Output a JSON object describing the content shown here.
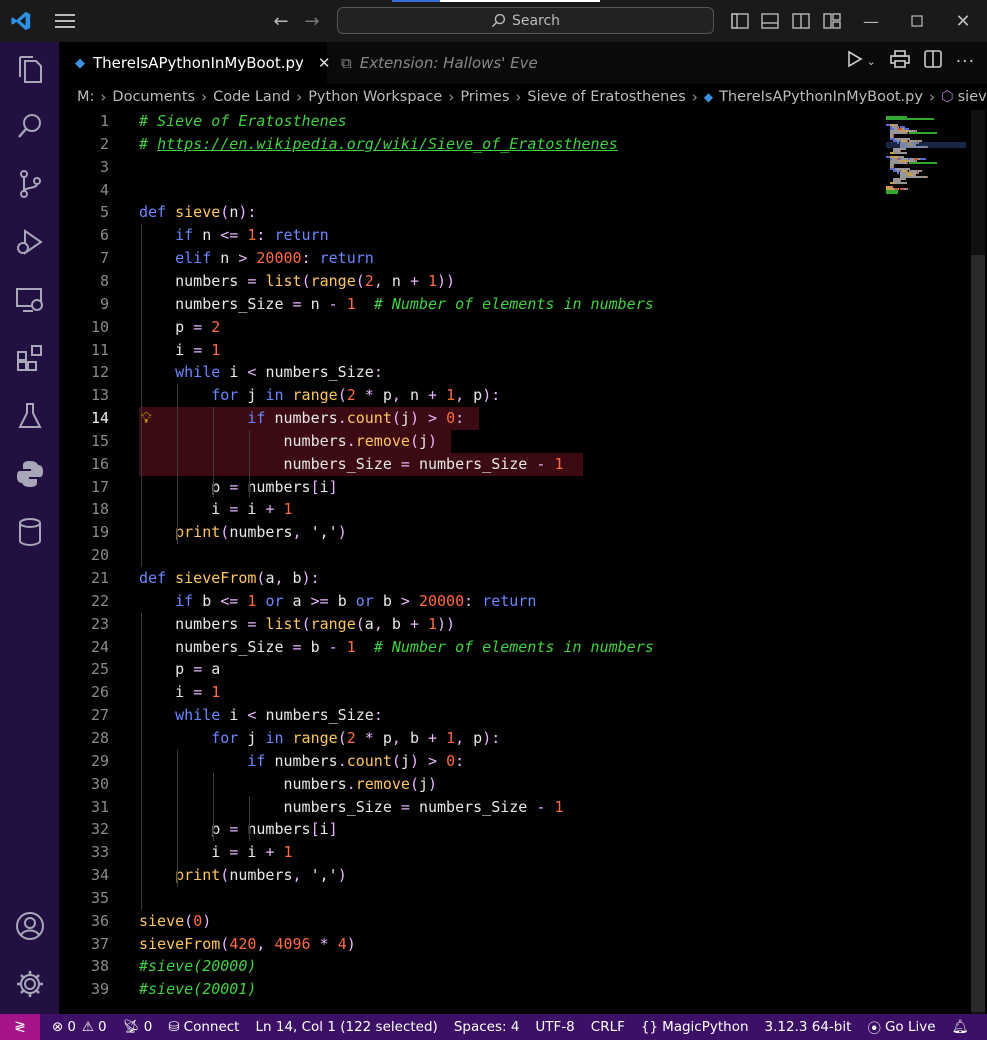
{
  "titlebar": {
    "search_placeholder": "Search"
  },
  "tabs": [
    {
      "label": "ThereIsAPythonInMyBoot.py",
      "active": true
    },
    {
      "label": "Extension: Hallows' Eve",
      "active": false
    }
  ],
  "breadcrumb": [
    "M:",
    "Documents",
    "Code Land",
    "Python Workspace",
    "Primes",
    "Sieve of Eratosthenes",
    "ThereIsAPythonInMyBoot.py",
    "sieve"
  ],
  "editor": {
    "current_line": 14,
    "selection_lines": [
      14,
      15,
      16
    ]
  },
  "code_lines": [
    [
      [
        "c",
        "# Sieve of Eratosthenes"
      ]
    ],
    [
      [
        "c",
        "# "
      ],
      [
        "cu",
        "https://en.wikipedia.org/wiki/Sieve_of_Eratosthenes"
      ]
    ],
    [],
    [],
    [
      [
        "k",
        "def "
      ],
      [
        "f",
        "sieve"
      ],
      [
        "o",
        "("
      ],
      [
        "t",
        "n"
      ],
      [
        "o",
        "):"
      ]
    ],
    [
      [
        "t",
        "    "
      ],
      [
        "k",
        "if "
      ],
      [
        "t",
        "n "
      ],
      [
        "o",
        "<= "
      ],
      [
        "n",
        "1"
      ],
      [
        "o",
        ": "
      ],
      [
        "k",
        "return"
      ]
    ],
    [
      [
        "t",
        "    "
      ],
      [
        "k",
        "elif "
      ],
      [
        "t",
        "n "
      ],
      [
        "o",
        "> "
      ],
      [
        "n",
        "20000"
      ],
      [
        "o",
        ": "
      ],
      [
        "k",
        "return"
      ]
    ],
    [
      [
        "t",
        "    numbers "
      ],
      [
        "o",
        "= "
      ],
      [
        "f",
        "list"
      ],
      [
        "o",
        "("
      ],
      [
        "f",
        "range"
      ],
      [
        "o",
        "("
      ],
      [
        "n",
        "2"
      ],
      [
        "o",
        ", "
      ],
      [
        "t",
        "n "
      ],
      [
        "o",
        "+ "
      ],
      [
        "n",
        "1"
      ],
      [
        "o",
        "))"
      ]
    ],
    [
      [
        "t",
        "    numbers_Size "
      ],
      [
        "o",
        "= "
      ],
      [
        "t",
        "n "
      ],
      [
        "o",
        "- "
      ],
      [
        "n",
        "1"
      ],
      [
        "t",
        "  "
      ],
      [
        "c",
        "# Number of elements in numbers"
      ]
    ],
    [
      [
        "t",
        "    p "
      ],
      [
        "o",
        "= "
      ],
      [
        "n",
        "2"
      ]
    ],
    [
      [
        "t",
        "    i "
      ],
      [
        "o",
        "= "
      ],
      [
        "n",
        "1"
      ]
    ],
    [
      [
        "t",
        "    "
      ],
      [
        "k",
        "while "
      ],
      [
        "t",
        "i "
      ],
      [
        "o",
        "< "
      ],
      [
        "t",
        "numbers_Size"
      ],
      [
        "o",
        ":"
      ]
    ],
    [
      [
        "t",
        "        "
      ],
      [
        "k",
        "for "
      ],
      [
        "t",
        "j "
      ],
      [
        "k",
        "in "
      ],
      [
        "f",
        "range"
      ],
      [
        "o",
        "("
      ],
      [
        "n",
        "2 "
      ],
      [
        "o",
        "* "
      ],
      [
        "t",
        "p"
      ],
      [
        "o",
        ", "
      ],
      [
        "t",
        "n "
      ],
      [
        "o",
        "+ "
      ],
      [
        "n",
        "1"
      ],
      [
        "o",
        ", "
      ],
      [
        "t",
        "p"
      ],
      [
        "o",
        "):"
      ]
    ],
    [
      [
        "t",
        "            "
      ],
      [
        "k",
        "if "
      ],
      [
        "t",
        "numbers"
      ],
      [
        "o",
        "."
      ],
      [
        "f",
        "count"
      ],
      [
        "o",
        "("
      ],
      [
        "t",
        "j"
      ],
      [
        "o",
        ") > "
      ],
      [
        "n",
        "0"
      ],
      [
        "o",
        ":"
      ]
    ],
    [
      [
        "t",
        "                numbers"
      ],
      [
        "o",
        "."
      ],
      [
        "f",
        "remove"
      ],
      [
        "o",
        "("
      ],
      [
        "t",
        "j"
      ],
      [
        "o",
        ")"
      ]
    ],
    [
      [
        "t",
        "                numbers_Size "
      ],
      [
        "o",
        "= "
      ],
      [
        "t",
        "numbers_Size "
      ],
      [
        "o",
        "- "
      ],
      [
        "n",
        "1"
      ]
    ],
    [
      [
        "t",
        "        p "
      ],
      [
        "o",
        "= "
      ],
      [
        "t",
        "numbers"
      ],
      [
        "o",
        "["
      ],
      [
        "t",
        "i"
      ],
      [
        "o",
        "]"
      ]
    ],
    [
      [
        "t",
        "        i "
      ],
      [
        "o",
        "= "
      ],
      [
        "t",
        "i "
      ],
      [
        "o",
        "+ "
      ],
      [
        "n",
        "1"
      ]
    ],
    [
      [
        "t",
        "    "
      ],
      [
        "f",
        "print"
      ],
      [
        "o",
        "("
      ],
      [
        "t",
        "numbers"
      ],
      [
        "o",
        ", "
      ],
      [
        "s",
        "','"
      ],
      [
        "o",
        ")"
      ]
    ],
    [],
    [
      [
        "k",
        "def "
      ],
      [
        "f",
        "sieveFrom"
      ],
      [
        "o",
        "("
      ],
      [
        "t",
        "a"
      ],
      [
        "o",
        ", "
      ],
      [
        "t",
        "b"
      ],
      [
        "o",
        "):"
      ]
    ],
    [
      [
        "t",
        "    "
      ],
      [
        "k",
        "if "
      ],
      [
        "t",
        "b "
      ],
      [
        "o",
        "<= "
      ],
      [
        "n",
        "1 "
      ],
      [
        "k",
        "or "
      ],
      [
        "t",
        "a "
      ],
      [
        "o",
        ">= "
      ],
      [
        "t",
        "b "
      ],
      [
        "k",
        "or "
      ],
      [
        "t",
        "b "
      ],
      [
        "o",
        "> "
      ],
      [
        "n",
        "20000"
      ],
      [
        "o",
        ": "
      ],
      [
        "k",
        "return"
      ]
    ],
    [
      [
        "t",
        "    numbers "
      ],
      [
        "o",
        "= "
      ],
      [
        "f",
        "list"
      ],
      [
        "o",
        "("
      ],
      [
        "f",
        "range"
      ],
      [
        "o",
        "("
      ],
      [
        "t",
        "a"
      ],
      [
        "o",
        ", "
      ],
      [
        "t",
        "b "
      ],
      [
        "o",
        "+ "
      ],
      [
        "n",
        "1"
      ],
      [
        "o",
        "))"
      ]
    ],
    [
      [
        "t",
        "    numbers_Size "
      ],
      [
        "o",
        "= "
      ],
      [
        "t",
        "b "
      ],
      [
        "o",
        "- "
      ],
      [
        "n",
        "1"
      ],
      [
        "t",
        "  "
      ],
      [
        "c",
        "# Number of elements in numbers"
      ]
    ],
    [
      [
        "t",
        "    p "
      ],
      [
        "o",
        "= "
      ],
      [
        "t",
        "a"
      ]
    ],
    [
      [
        "t",
        "    i "
      ],
      [
        "o",
        "= "
      ],
      [
        "n",
        "1"
      ]
    ],
    [
      [
        "t",
        "    "
      ],
      [
        "k",
        "while "
      ],
      [
        "t",
        "i "
      ],
      [
        "o",
        "< "
      ],
      [
        "t",
        "numbers_Size"
      ],
      [
        "o",
        ":"
      ]
    ],
    [
      [
        "t",
        "        "
      ],
      [
        "k",
        "for "
      ],
      [
        "t",
        "j "
      ],
      [
        "k",
        "in "
      ],
      [
        "f",
        "range"
      ],
      [
        "o",
        "("
      ],
      [
        "n",
        "2 "
      ],
      [
        "o",
        "* "
      ],
      [
        "t",
        "p"
      ],
      [
        "o",
        ", "
      ],
      [
        "t",
        "b "
      ],
      [
        "o",
        "+ "
      ],
      [
        "n",
        "1"
      ],
      [
        "o",
        ", "
      ],
      [
        "t",
        "p"
      ],
      [
        "o",
        "):"
      ]
    ],
    [
      [
        "t",
        "            "
      ],
      [
        "k",
        "if "
      ],
      [
        "t",
        "numbers"
      ],
      [
        "o",
        "."
      ],
      [
        "f",
        "count"
      ],
      [
        "o",
        "("
      ],
      [
        "t",
        "j"
      ],
      [
        "o",
        ") > "
      ],
      [
        "n",
        "0"
      ],
      [
        "o",
        ":"
      ]
    ],
    [
      [
        "t",
        "                numbers"
      ],
      [
        "o",
        "."
      ],
      [
        "f",
        "remove"
      ],
      [
        "o",
        "("
      ],
      [
        "t",
        "j"
      ],
      [
        "o",
        ")"
      ]
    ],
    [
      [
        "t",
        "                numbers_Size "
      ],
      [
        "o",
        "= "
      ],
      [
        "t",
        "numbers_Size "
      ],
      [
        "o",
        "- "
      ],
      [
        "n",
        "1"
      ]
    ],
    [
      [
        "t",
        "        p "
      ],
      [
        "o",
        "= "
      ],
      [
        "t",
        "numbers"
      ],
      [
        "o",
        "["
      ],
      [
        "t",
        "i"
      ],
      [
        "o",
        "]"
      ]
    ],
    [
      [
        "t",
        "        i "
      ],
      [
        "o",
        "= "
      ],
      [
        "t",
        "i "
      ],
      [
        "o",
        "+ "
      ],
      [
        "n",
        "1"
      ]
    ],
    [
      [
        "t",
        "    "
      ],
      [
        "f",
        "print"
      ],
      [
        "o",
        "("
      ],
      [
        "t",
        "numbers"
      ],
      [
        "o",
        ", "
      ],
      [
        "s",
        "','"
      ],
      [
        "o",
        ")"
      ]
    ],
    [],
    [
      [
        "f",
        "sieve"
      ],
      [
        "o",
        "("
      ],
      [
        "n",
        "0"
      ],
      [
        "o",
        ")"
      ]
    ],
    [
      [
        "f",
        "sieveFrom"
      ],
      [
        "o",
        "("
      ],
      [
        "n",
        "420"
      ],
      [
        "o",
        ", "
      ],
      [
        "n",
        "4096 "
      ],
      [
        "o",
        "* "
      ],
      [
        "n",
        "4"
      ],
      [
        "o",
        ")"
      ]
    ],
    [
      [
        "c",
        "#sieve(20000)"
      ]
    ],
    [
      [
        "c",
        "#sieve(20001)"
      ]
    ]
  ],
  "status": {
    "errors": "0",
    "warnings": "0",
    "ports": "0",
    "connect": "Connect",
    "position": "Ln 14, Col 1 (122 selected)",
    "spaces": "Spaces: 4",
    "encoding": "UTF-8",
    "eol": "CRLF",
    "language": "MagicPython",
    "interpreter": "3.12.3 64-bit",
    "golive": "Go Live"
  },
  "colors": {
    "activity_bar": "#221042",
    "status_bar": "#3b1066",
    "remote": "#a4138a",
    "keyword": "#6d86ff",
    "function": "#ffc65c",
    "number": "#ff6a3d",
    "comment": "#3fd13f"
  }
}
